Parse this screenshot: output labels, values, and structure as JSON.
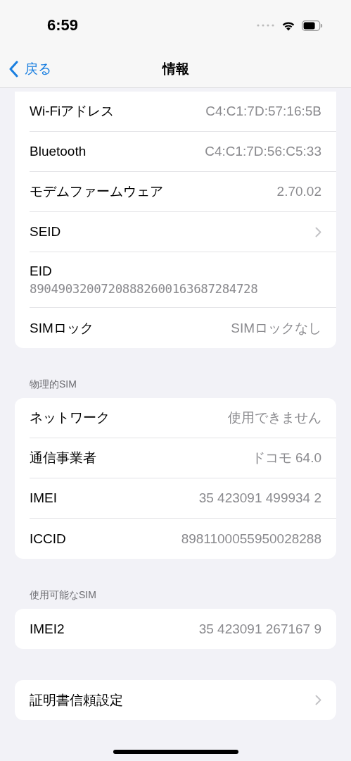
{
  "status_bar": {
    "time": "6:59"
  },
  "nav": {
    "back": "戻る",
    "title": "情報"
  },
  "sections": [
    {
      "rows": [
        {
          "kind": "value",
          "label": "Wi-Fiアドレス",
          "value": "C4:C1:7D:57:16:5B"
        },
        {
          "kind": "value",
          "label": "Bluetooth",
          "value": "C4:C1:7D:56:C5:33"
        },
        {
          "kind": "value",
          "label": "モデムファームウェア",
          "value": "2.70.02"
        },
        {
          "kind": "chevron",
          "label": "SEID"
        },
        {
          "kind": "stacked",
          "label": "EID",
          "value": "89049032007208882600163687284728"
        },
        {
          "kind": "value",
          "label": "SIMロック",
          "value": "SIMロックなし"
        }
      ]
    },
    {
      "header": "物理的SIM",
      "rows": [
        {
          "kind": "value",
          "label": "ネットワーク",
          "value": "使用できません"
        },
        {
          "kind": "value",
          "label": "通信事業者",
          "value": "ドコモ 64.0"
        },
        {
          "kind": "value",
          "label": "IMEI",
          "value": "35 423091 499934 2"
        },
        {
          "kind": "value",
          "label": "ICCID",
          "value": "8981100055950028288"
        }
      ]
    },
    {
      "header": "使用可能なSIM",
      "rows": [
        {
          "kind": "value",
          "label": "IMEI2",
          "value": "35 423091 267167 9"
        }
      ]
    },
    {
      "rows": [
        {
          "kind": "chevron",
          "label": "証明書信頼設定"
        }
      ]
    }
  ]
}
